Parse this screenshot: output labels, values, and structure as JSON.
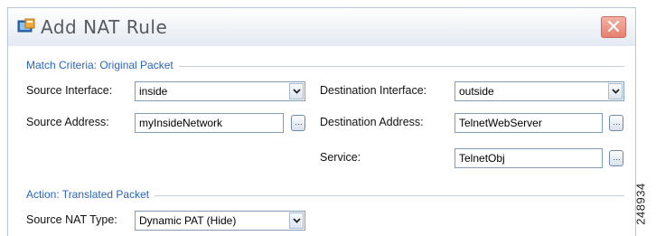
{
  "dialog": {
    "title": "Add NAT Rule"
  },
  "match_section": {
    "label": "Match Criteria: Original Packet",
    "source_interface": {
      "label": "Source Interface:",
      "value": "inside"
    },
    "destination_interface": {
      "label": "Destination Interface:",
      "value": "outside"
    },
    "source_address": {
      "label": "Source Address:",
      "value": "myInsideNetwork"
    },
    "destination_address": {
      "label": "Destination Address:",
      "value": "TelnetWebServer"
    },
    "service": {
      "label": "Service:",
      "value": "TelnetObj"
    }
  },
  "action_section": {
    "label": "Action: Translated Packet",
    "source_nat_type": {
      "label": "Source NAT Type:",
      "value": "Dynamic PAT (Hide)"
    }
  },
  "figure_number": "248934",
  "colors": {
    "section_label": "#2a64b8",
    "close_button": "#e7806e",
    "field_border": "#7f9db9"
  }
}
